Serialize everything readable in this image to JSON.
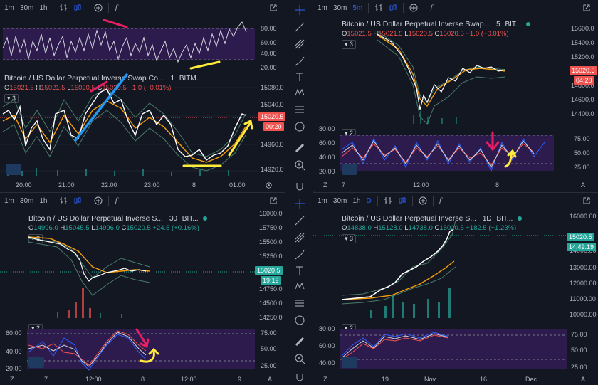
{
  "toolbar": {
    "tl": {
      "int1": "1m",
      "int2": "30m",
      "int3": "1h"
    },
    "tr": {
      "int1": "1m",
      "int2": "30m",
      "int3": "5m"
    },
    "bl": {
      "int1": "1m",
      "int2": "30m",
      "int3": "1h"
    },
    "br": {
      "int1": "1m",
      "int2": "30m",
      "int3": "1h",
      "int4": "D"
    },
    "fx": "f"
  },
  "panes": {
    "tl": {
      "title": "Bitcoin / US Dollar Perpetual Inverse Swap Co...",
      "interval": "1",
      "exchange": "BITM...",
      "ohlc": {
        "o": "15021.5",
        "h": "15021.5",
        "l": "15020.5",
        "c": "15020.5",
        "chg": "−1.0 (−0.01%)"
      },
      "count": "3",
      "price_label": "15020.5",
      "countdown": "00:20",
      "price_ticks": [
        "15080.0",
        "15040.0",
        "15000.0",
        "14960.0",
        "14920.0"
      ],
      "rsi_ticks": [
        "80.00",
        "60.00",
        "40.00",
        "20.00"
      ],
      "time_ticks": [
        "20:00",
        "21:00",
        "22:00",
        "23:00",
        "8",
        "01:00"
      ]
    },
    "tr": {
      "title": "Bitcoin / US Dollar Perpetual Inverse Swap...",
      "interval": "5",
      "exchange": "BIT...",
      "ohlc": {
        "o": "15021.5",
        "h": "15021.5",
        "l": "15020.5",
        "c": "15020.5",
        "chg": "−1.0 (−0.01%)"
      },
      "count": "3",
      "rsi_count": "2",
      "price_label": "15020.5",
      "countdown": "04:20",
      "price_ticks": [
        "15600.0",
        "15400.0",
        "15200.0",
        "15000.0",
        "14800.0",
        "14600.0",
        "14400.0"
      ],
      "rsi_right_ticks": [
        "75.00",
        "50.00",
        "25.00"
      ],
      "rsi_left_ticks": [
        "80.00",
        "60.00",
        "40.00",
        "20.00"
      ],
      "time_ticks": [
        "Z",
        "7",
        "12:00",
        "8",
        "A"
      ]
    },
    "bl": {
      "title": "Bitcoin / US Dollar Perpetual Inverse S...",
      "interval": "30",
      "exchange": "BIT...",
      "ohlc": {
        "o": "14996.0",
        "h": "15045.5",
        "l": "14996.0",
        "c": "15020.5",
        "chg": "+24.5 (+0.16%)"
      },
      "count": "3",
      "rsi_count": "2",
      "price_label": "15020.5",
      "countdown": "19:19",
      "price_ticks": [
        "16000.0",
        "15750.0",
        "15500.0",
        "15250.0",
        "14750.0",
        "14500.0",
        "14250.0"
      ],
      "rsi_right_ticks": [
        "75.00",
        "50.00",
        "25.00"
      ],
      "rsi_left_ticks": [
        "60.00",
        "40.00",
        "20.00"
      ],
      "time_ticks": [
        "Z",
        "7",
        "12:00",
        "8",
        "12:00",
        "9",
        "A"
      ]
    },
    "br": {
      "title": "Bitcoin / US Dollar Perpetual Inverse S...",
      "interval": "1D",
      "exchange": "BIT...",
      "ohlc": {
        "o": "14838.0",
        "h": "15128.0",
        "l": "14738.0",
        "c": "15020.5",
        "chg": "+182.5 (+1.23%)"
      },
      "count": "3",
      "rsi_count": "2",
      "price_label": "15020.5",
      "countdown": "14:49:19",
      "price_ticks": [
        "16000.00",
        "14000.00",
        "13000.00",
        "12000.00",
        "11000.00",
        "10000.00"
      ],
      "rsi_right_ticks": [
        "75.00",
        "50.00",
        "25.00"
      ],
      "rsi_left_ticks": [
        "80.00",
        "60.00",
        "40.00"
      ],
      "time_ticks": [
        "Z",
        "19",
        "Nov",
        "16",
        "Dec",
        "A"
      ]
    }
  },
  "colors": {
    "bg": "#131722",
    "rsi_fill": "#2d1b4e",
    "up": "#26a69a",
    "down": "#ef5350",
    "blue": "#2962ff"
  }
}
